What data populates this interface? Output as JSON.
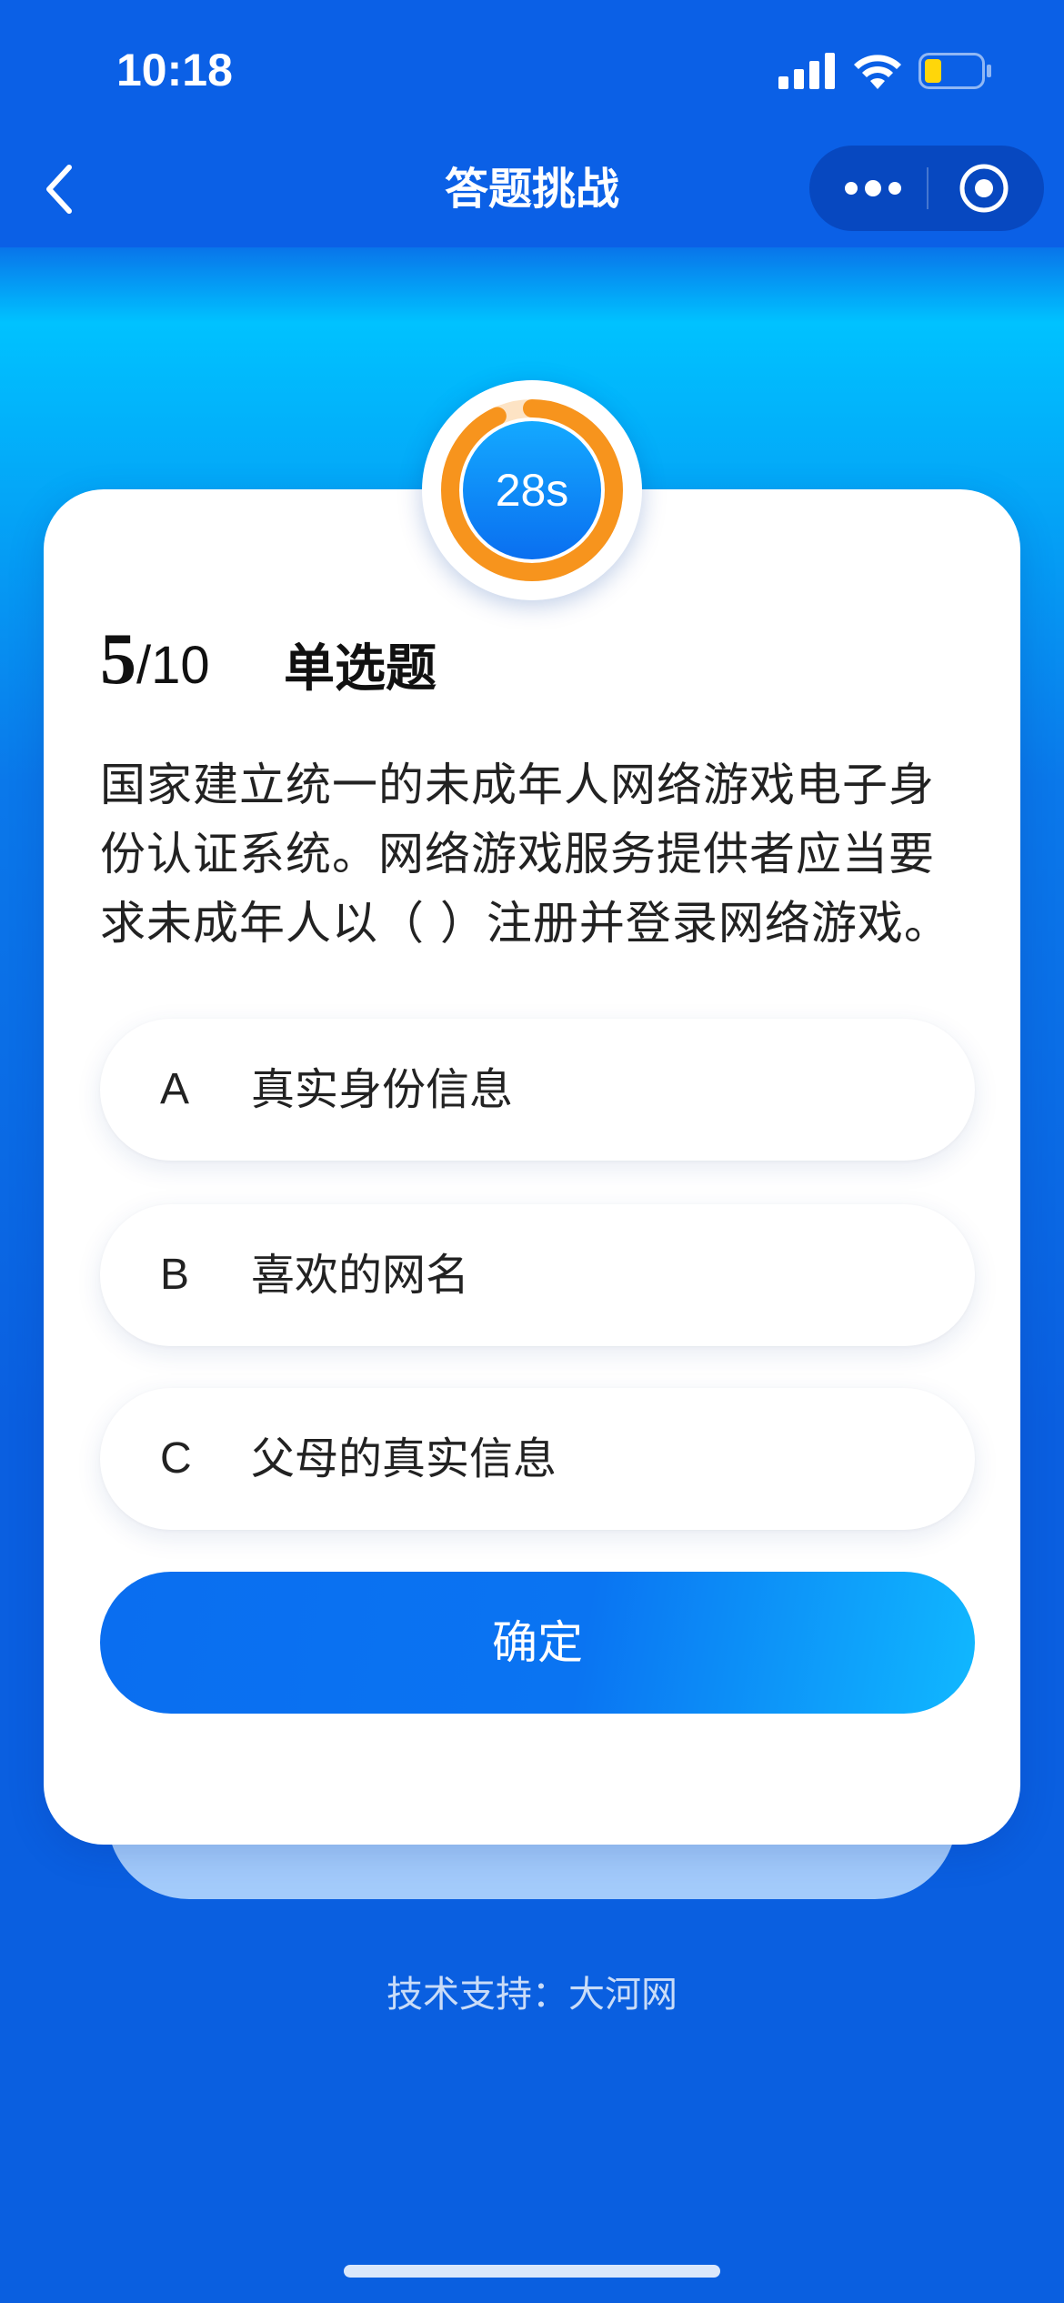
{
  "status_bar": {
    "time": "10:18"
  },
  "nav": {
    "title": "答题挑战"
  },
  "timer": {
    "text": "28s",
    "remaining_fraction": 0.93
  },
  "question": {
    "current": "5",
    "total": "/10",
    "type": "单选题",
    "text": "国家建立统一的未成年人网络游戏电子身份认证系统。网络游戏服务提供者应当要求未成年人以（ ）注册并登录网络游戏。"
  },
  "options": [
    {
      "letter": "A",
      "label": "真实身份信息"
    },
    {
      "letter": "B",
      "label": "喜欢的网名"
    },
    {
      "letter": "C",
      "label": "父母的真实信息"
    }
  ],
  "confirm_label": "确定",
  "footer": "技术支持：大河网",
  "colors": {
    "primary": "#0b60e6",
    "timer_ring": "#f7941d",
    "card": "#ffffff"
  },
  "icons": [
    "back-chevron-icon",
    "more-dots-icon",
    "close-target-icon",
    "signal-icon",
    "wifi-icon",
    "battery-icon"
  ]
}
